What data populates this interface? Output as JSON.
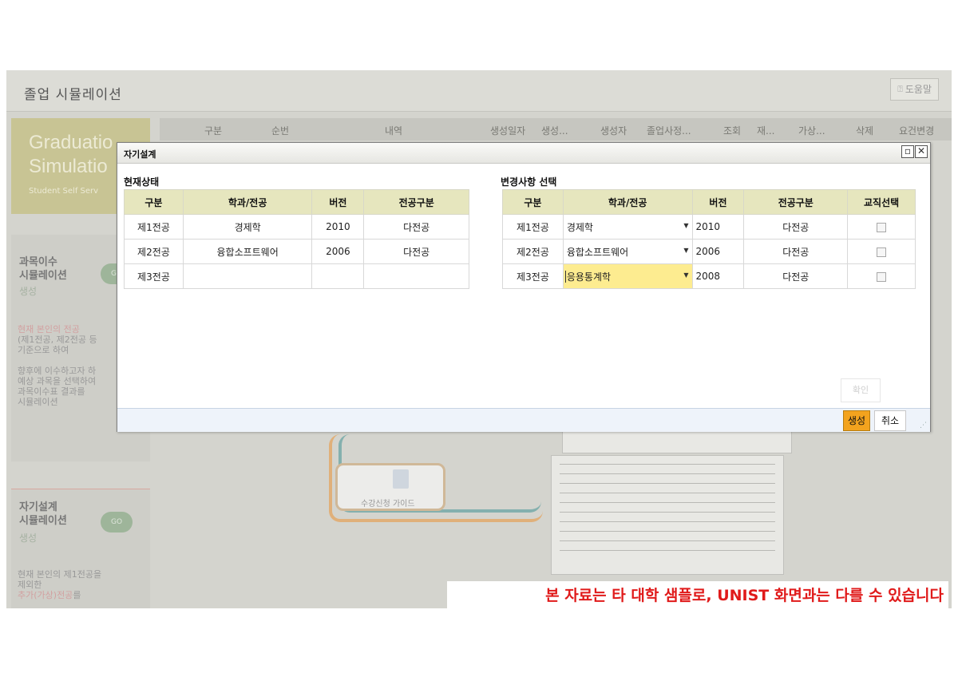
{
  "app": {
    "title": "졸업 시뮬레이션",
    "help_label": "도움말",
    "graduation_title_line1": "Graduatio",
    "graduation_title_line2": "Simulatio",
    "graduation_subtitle": "Student Self Serv",
    "grid_headers": [
      "구분",
      "순번",
      "내역",
      "생성일자",
      "생성...",
      "생성자",
      "졸업사정...",
      "조회",
      "재...",
      "가상...",
      "삭제",
      "요건변경"
    ],
    "sidebar": {
      "course_sim": {
        "title_line1": "과목이수",
        "title_line2": "시뮬레이션",
        "link": "생성"
      },
      "course_desc": {
        "line1": "현재 본인의 전공",
        "line2": "(제1전공, 제2전공 등",
        "line3": "기준으로 하여",
        "line4": "향후에 이수하고자 하",
        "line5": "예상 과목을 선택하여",
        "line6": "과목이수표 결과를",
        "line7": "시뮬레이션"
      },
      "self_sim": {
        "title_line1": "자기설계",
        "title_line2": "시뮬레이션",
        "link": "생성"
      },
      "self_desc": {
        "line1": "현재 본인의 제1전공을",
        "line2": "제외한",
        "line3": "추가(가상)전공",
        "line3_suffix": "를"
      }
    },
    "guide_label": "수강신청 가이드"
  },
  "dialog": {
    "title": "자기설계",
    "current_label": "현재상태",
    "change_label": "변경사항 선택",
    "current_table": {
      "headers": [
        "구분",
        "학과/전공",
        "버전",
        "전공구분"
      ],
      "rows": [
        {
          "type": "제1전공",
          "major": "경제학",
          "version": "2010",
          "category": "다전공"
        },
        {
          "type": "제2전공",
          "major": "융합소프트웨어",
          "version": "2006",
          "category": "다전공"
        },
        {
          "type": "제3전공",
          "major": "",
          "version": "",
          "category": ""
        }
      ]
    },
    "change_table": {
      "headers": [
        "구분",
        "학과/전공",
        "버전",
        "전공구분",
        "교직선택"
      ],
      "rows": [
        {
          "type": "제1전공",
          "major": "경제학",
          "version": "2010",
          "category": "다전공",
          "teaching": false
        },
        {
          "type": "제2전공",
          "major": "융합소프트웨어",
          "version": "2006",
          "category": "다전공",
          "teaching": false
        },
        {
          "type": "제3전공",
          "major": "응용통계학",
          "version": "2008",
          "category": "다전공",
          "teaching": false
        }
      ]
    },
    "confirm_label": "확인",
    "create_label": "생성",
    "cancel_label": "취소"
  },
  "disclaimer": "본 자료는 타 대학 샘플로, UNIST 화면과는 다를 수 있습니다",
  "colors": {
    "header_bg": "#e6e6be",
    "active_select": "#fdec90",
    "create_button": "#f3a31e",
    "disclaimer": "#e01a1a"
  }
}
